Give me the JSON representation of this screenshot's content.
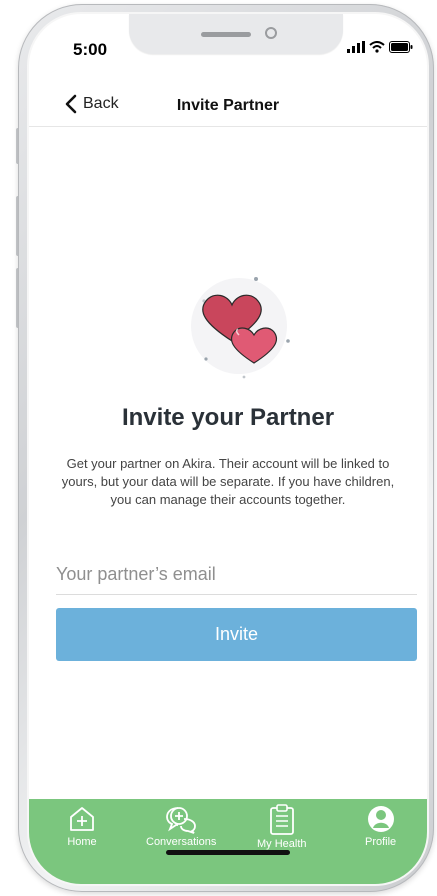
{
  "status_bar": {
    "time": "5:00"
  },
  "nav": {
    "back_label": "Back",
    "title": "Invite Partner"
  },
  "content": {
    "heading": "Invite your Partner",
    "description": "Get your partner on Akira. Their account will be linked to yours, but your data will be separate. If you have children, you can manage their accounts together.",
    "email_placeholder": "Your partner’s email",
    "invite_label": "Invite"
  },
  "tabs": [
    {
      "label": "Home",
      "icon": "home-plus-icon"
    },
    {
      "label": "Conversations",
      "icon": "chat-icon"
    },
    {
      "label": "My Health",
      "icon": "clipboard-icon"
    },
    {
      "label": "Profile",
      "icon": "profile-icon"
    }
  ],
  "colors": {
    "accent": "#6cb1db",
    "tab_bar": "#7bc67e",
    "heart": "#d74a63"
  }
}
